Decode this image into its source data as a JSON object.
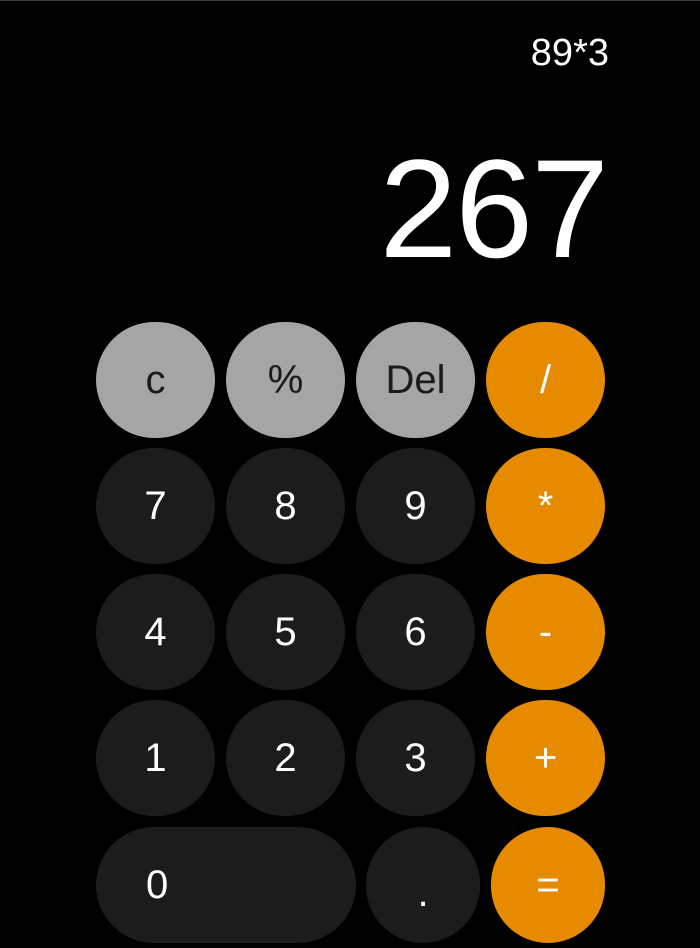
{
  "display": {
    "expression": "89*3",
    "result": "267"
  },
  "keys": {
    "clear": "c",
    "percent": "%",
    "delete": "Del",
    "divide": "/",
    "seven": "7",
    "eight": "8",
    "nine": "9",
    "multiply": "*",
    "four": "4",
    "five": "5",
    "six": "6",
    "subtract": "-",
    "one": "1",
    "two": "2",
    "three": "3",
    "add": "+",
    "zero": "0",
    "decimal": ".",
    "equals": "="
  },
  "colors": {
    "background": "#000000",
    "function_key": "#a5a5a5",
    "number_key": "#1c1c1c",
    "operator_key": "#e68a00",
    "text": "#ffffff"
  }
}
